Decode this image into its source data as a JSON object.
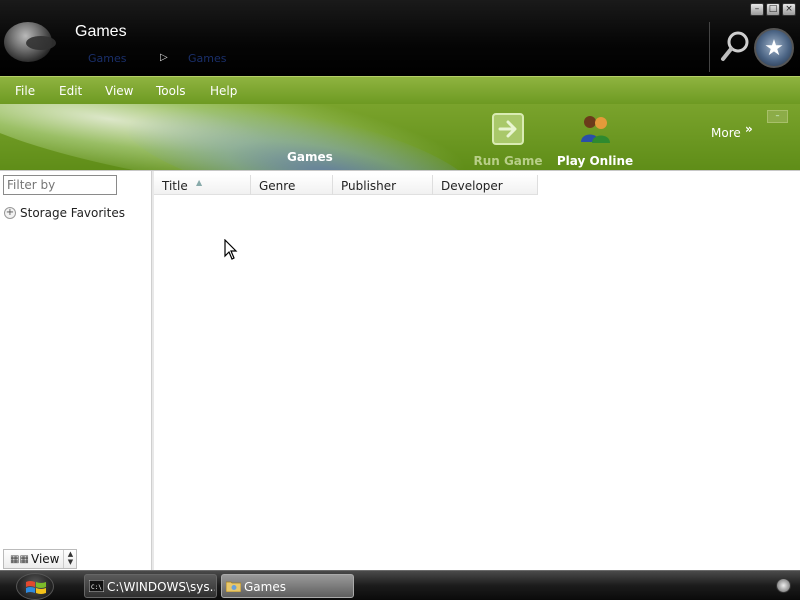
{
  "window": {
    "title": "Games",
    "breadcrumb": [
      "Games",
      "Games"
    ],
    "controls": {
      "minimize": "minimize",
      "maximize": "maximize",
      "close": "close"
    }
  },
  "menu": [
    "File",
    "Edit",
    "View",
    "Tools",
    "Help"
  ],
  "toolbar": {
    "banner_title": "Games",
    "run_game": "Run Game",
    "play_online": "Play Online",
    "more": "More"
  },
  "sidebar": {
    "filter_placeholder": "Filter by",
    "favorites": "Storage Favorites",
    "view_label": "View"
  },
  "table": {
    "columns": [
      "Title",
      "Genre",
      "Publisher",
      "Developer"
    ],
    "sort_column": "Title",
    "sort_direction": "ascending",
    "rows": []
  },
  "taskbar": {
    "tasks": [
      {
        "label": "C:\\WINDOWS\\sys...",
        "icon": "cmd-icon",
        "active": false
      },
      {
        "label": "Games",
        "icon": "games-folder-icon",
        "active": true
      }
    ]
  },
  "colors": {
    "accent_green": "#6d9a22",
    "title_black": "#000000",
    "banner_blue_swoosh": "#5a6ec8"
  }
}
